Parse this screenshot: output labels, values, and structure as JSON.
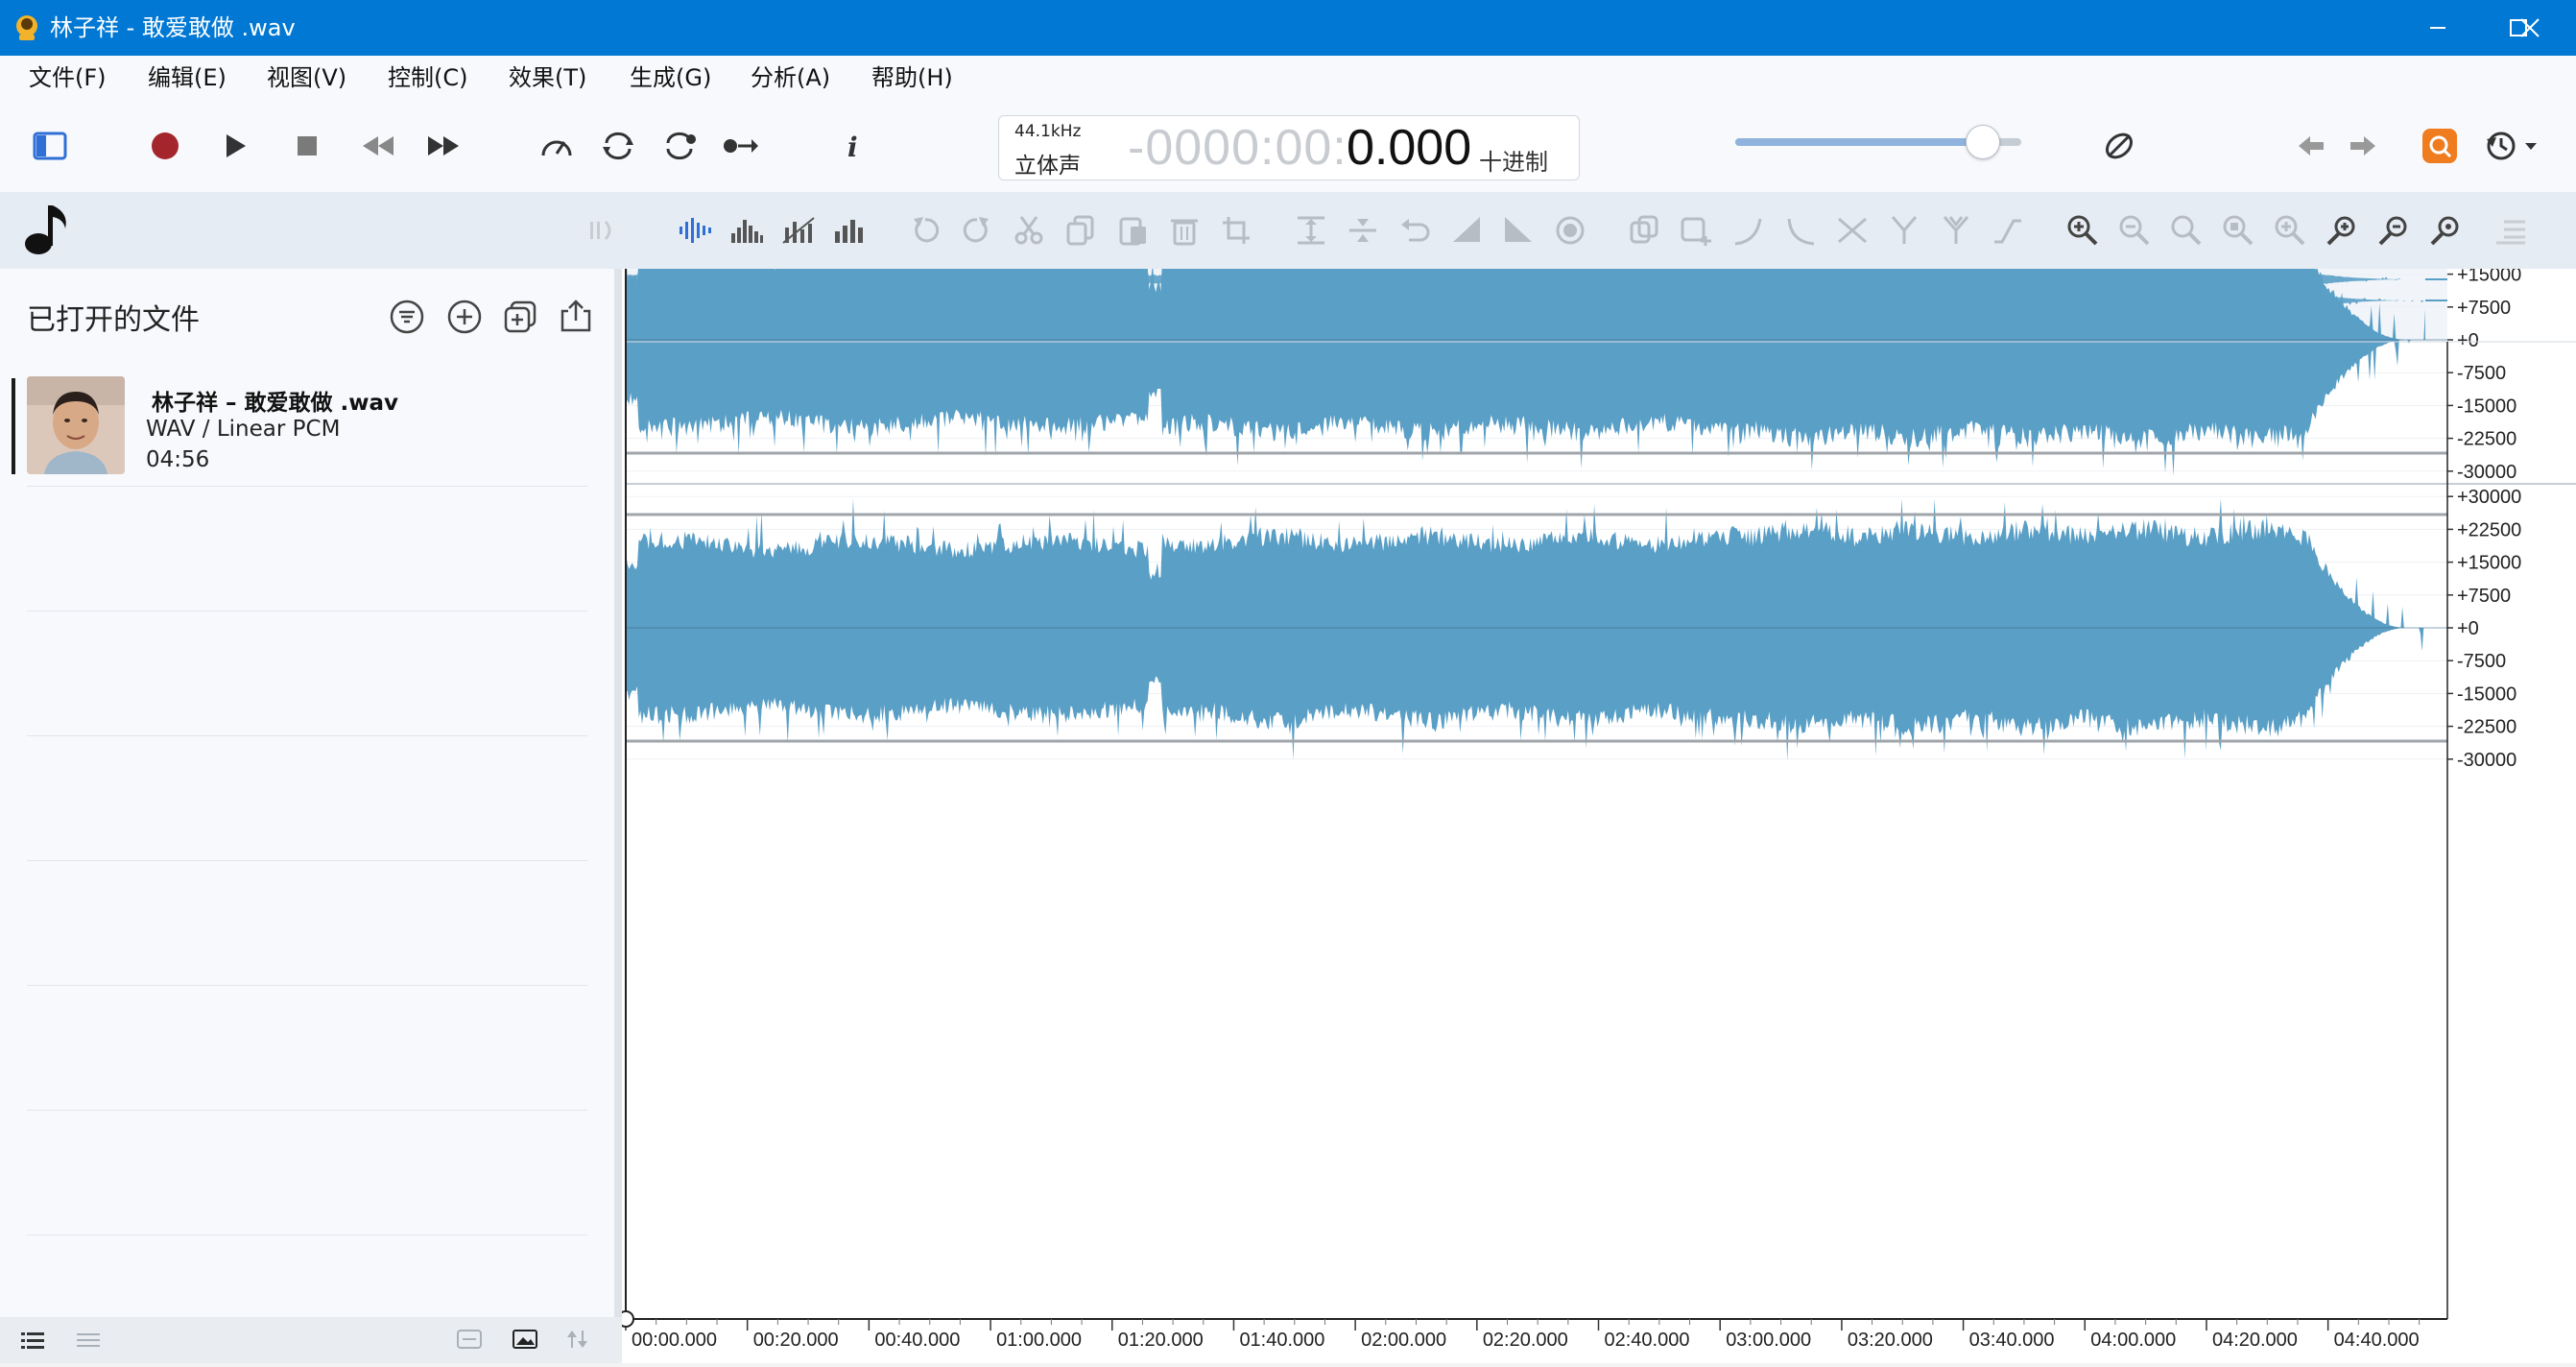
{
  "window": {
    "title": "林子祥 - 敢爱敢做 .wav"
  },
  "menu": {
    "items": [
      "文件(F)",
      "编辑(E)",
      "视图(V)",
      "控制(C)",
      "效果(T)",
      "生成(G)",
      "分析(A)",
      "帮助(H)"
    ]
  },
  "display": {
    "sample_rate": "44.1kHz",
    "channels": "立体声",
    "time_faded": "-0000:00:0",
    "time_main": "0.000",
    "time_format": "十进制"
  },
  "left_panel": {
    "title": "已打开的文件",
    "file": {
      "name": "林子祥 – 敢爱敢做 .wav",
      "format": "WAV / Linear PCM",
      "duration": "04:56"
    }
  },
  "waveform": {
    "amplitude_ticks": [
      "+30000",
      "+22500",
      "+15000",
      "+7500",
      "+0",
      "-7500",
      "-15000",
      "-22500",
      "-30000"
    ],
    "time_ticks": [
      "00:00.000",
      "00:20.000",
      "00:40.000",
      "01:00.000",
      "01:20.000",
      "01:40.000",
      "02:00.000",
      "02:20.000",
      "02:40.000",
      "03:00.000",
      "03:20.000",
      "03:40.000",
      "04:00.000",
      "04:20.000",
      "04:40.000"
    ],
    "wave_color": "#5a9fc6"
  },
  "colors": {
    "titlebar": "#0078d4",
    "accent": "#2f6fd6",
    "record": "#a4262c"
  }
}
